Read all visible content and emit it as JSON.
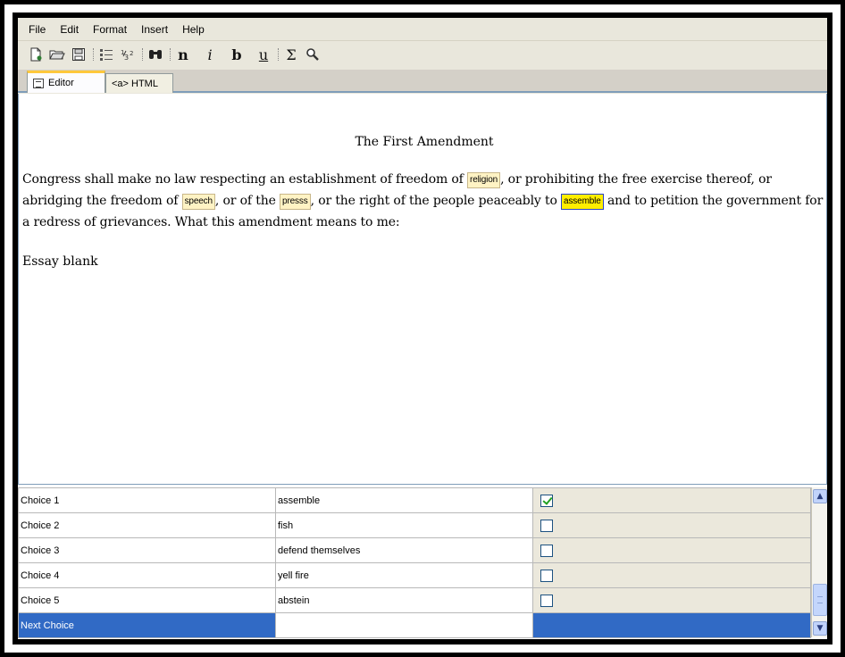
{
  "menu": [
    "File",
    "Edit",
    "Format",
    "Insert",
    "Help"
  ],
  "toolbar": {
    "icons": [
      "new-document-icon",
      "open-folder-icon",
      "save-icon",
      "list-icon",
      "numbering-icon",
      "find-icon",
      "normal-text-icon",
      "italic-icon",
      "bold-icon",
      "underline-icon",
      "sigma-icon",
      "zoom-icon"
    ],
    "normal_glyph": "n",
    "italic_glyph": "i",
    "bold_glyph": "b",
    "underline_glyph": "u",
    "sigma_glyph": "Σ"
  },
  "tabs": [
    {
      "label": "Editor",
      "active": true
    },
    {
      "label": "<a> HTML",
      "active": false
    }
  ],
  "document": {
    "title": "The First Amendment",
    "text_1": "Congress shall make no law respecting an establishment of freedom of ",
    "blank_1": "religion",
    "text_2": ", or prohibiting the free exercise thereof, or abridging the freedom of ",
    "blank_2": "speech",
    "text_3": ", or of the ",
    "blank_3": "presss",
    "text_4": ", or the right of the people peaceably to ",
    "blank_4": "assemble",
    "text_5": " and to petition the government for a redress of grievances.  What this amendment means to me:",
    "essay": "Essay blank"
  },
  "choices": [
    {
      "label": "Choice 1",
      "value": "assemble",
      "checked": true
    },
    {
      "label": "Choice 2",
      "value": "fish",
      "checked": false
    },
    {
      "label": "Choice 3",
      "value": "defend themselves",
      "checked": false
    },
    {
      "label": "Choice 4",
      "value": "yell fire",
      "checked": false
    },
    {
      "label": "Choice 5",
      "value": "abstein",
      "checked": false
    }
  ],
  "next_choice": {
    "label": "Next Choice",
    "value": ""
  },
  "colors": {
    "selection": "#316ac5",
    "blank_highlight": "#ffee00",
    "tab_accent": "#ffc83c"
  }
}
